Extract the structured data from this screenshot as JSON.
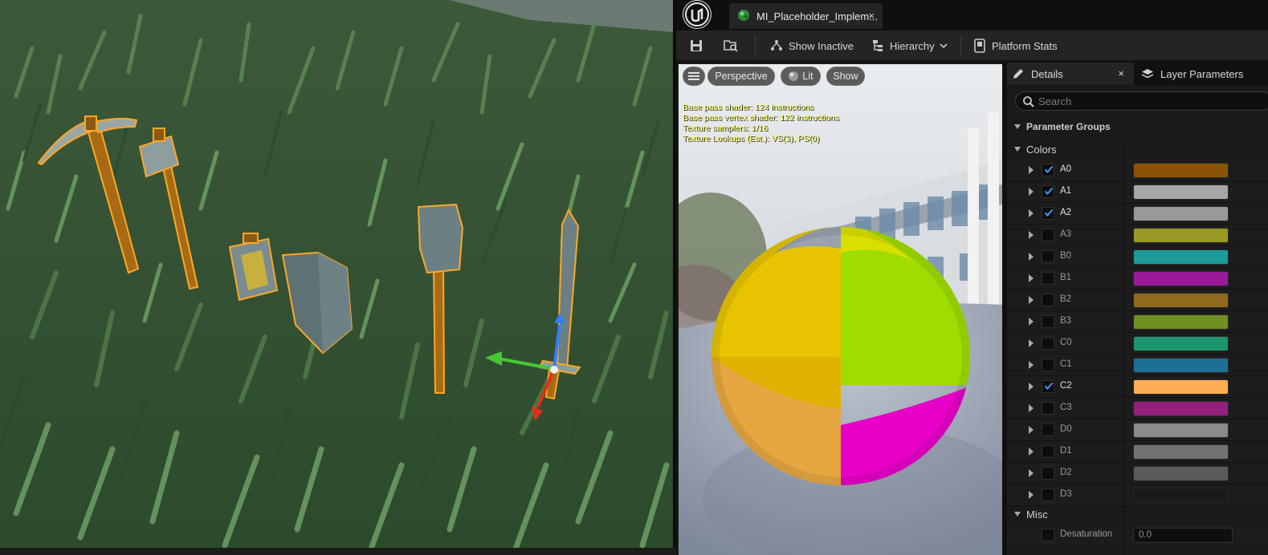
{
  "window": {
    "tab_title": "MI_Placeholder_Implem...",
    "tab_close": "×"
  },
  "toolbar": {
    "show_inactive": "Show Inactive",
    "hierarchy": "Hierarchy",
    "platform_stats": "Platform Stats"
  },
  "preview": {
    "perspective": "Perspective",
    "lit": "Lit",
    "show": "Show",
    "stats": [
      "Base pass shader: 124 instructions",
      "Base pass vertex shader: 122 instructions",
      "Texture samplers: 1/16",
      "Texture Lookups (Est.): VS(3), PS(0)"
    ]
  },
  "details": {
    "tab_details": "Details",
    "tab_close": "×",
    "tab_layer_parameters": "Layer Parameters",
    "search_placeholder": "Search",
    "parameter_groups": "Parameter Groups",
    "colors_group": "Colors",
    "misc_group": "Misc",
    "colors": [
      {
        "name": "A0",
        "checked": true,
        "color": "#8a5305"
      },
      {
        "name": "A1",
        "checked": true,
        "color": "#a6a6a6"
      },
      {
        "name": "A2",
        "checked": true,
        "color": "#999999"
      },
      {
        "name": "A3",
        "checked": false,
        "color": "#9b9823"
      },
      {
        "name": "B0",
        "checked": false,
        "color": "#1a9a9a"
      },
      {
        "name": "B1",
        "checked": false,
        "color": "#9a1a9a"
      },
      {
        "name": "B2",
        "checked": false,
        "color": "#8f6a1e"
      },
      {
        "name": "B3",
        "checked": false,
        "color": "#6f9022"
      },
      {
        "name": "C0",
        "checked": false,
        "color": "#1c9470"
      },
      {
        "name": "C1",
        "checked": false,
        "color": "#1e6f94"
      },
      {
        "name": "C2",
        "checked": true,
        "color": "#ffae55"
      },
      {
        "name": "C3",
        "checked": false,
        "color": "#941f7c"
      },
      {
        "name": "D0",
        "checked": false,
        "color": "#8a8a8a"
      },
      {
        "name": "D1",
        "checked": false,
        "color": "#727272"
      },
      {
        "name": "D2",
        "checked": false,
        "color": "#5a5a5a"
      },
      {
        "name": "D3",
        "checked": false,
        "color": "#1a1a1a"
      }
    ],
    "misc": [
      {
        "name": "Desaturation",
        "checked": false,
        "value": "0.0"
      }
    ]
  },
  "icons": [
    "unreal-logo-icon",
    "material-instance-icon",
    "save-icon",
    "browse-asset-icon",
    "show-inactive-icon",
    "hierarchy-icon",
    "chevron-down-icon",
    "platform-stats-icon",
    "hamburger-menu-icon",
    "lit-sphere-icon",
    "details-pencil-icon",
    "layers-icon",
    "search-icon",
    "triangle-expand-icon",
    "checkbox-tick-icon"
  ],
  "colors": {
    "panel_bg": "#1a1a1a",
    "toolbar_bg": "#242424",
    "tab_bg": "#0f0f0f",
    "stats_text": "#ffff5a",
    "selection_outline": "#ffa726"
  }
}
